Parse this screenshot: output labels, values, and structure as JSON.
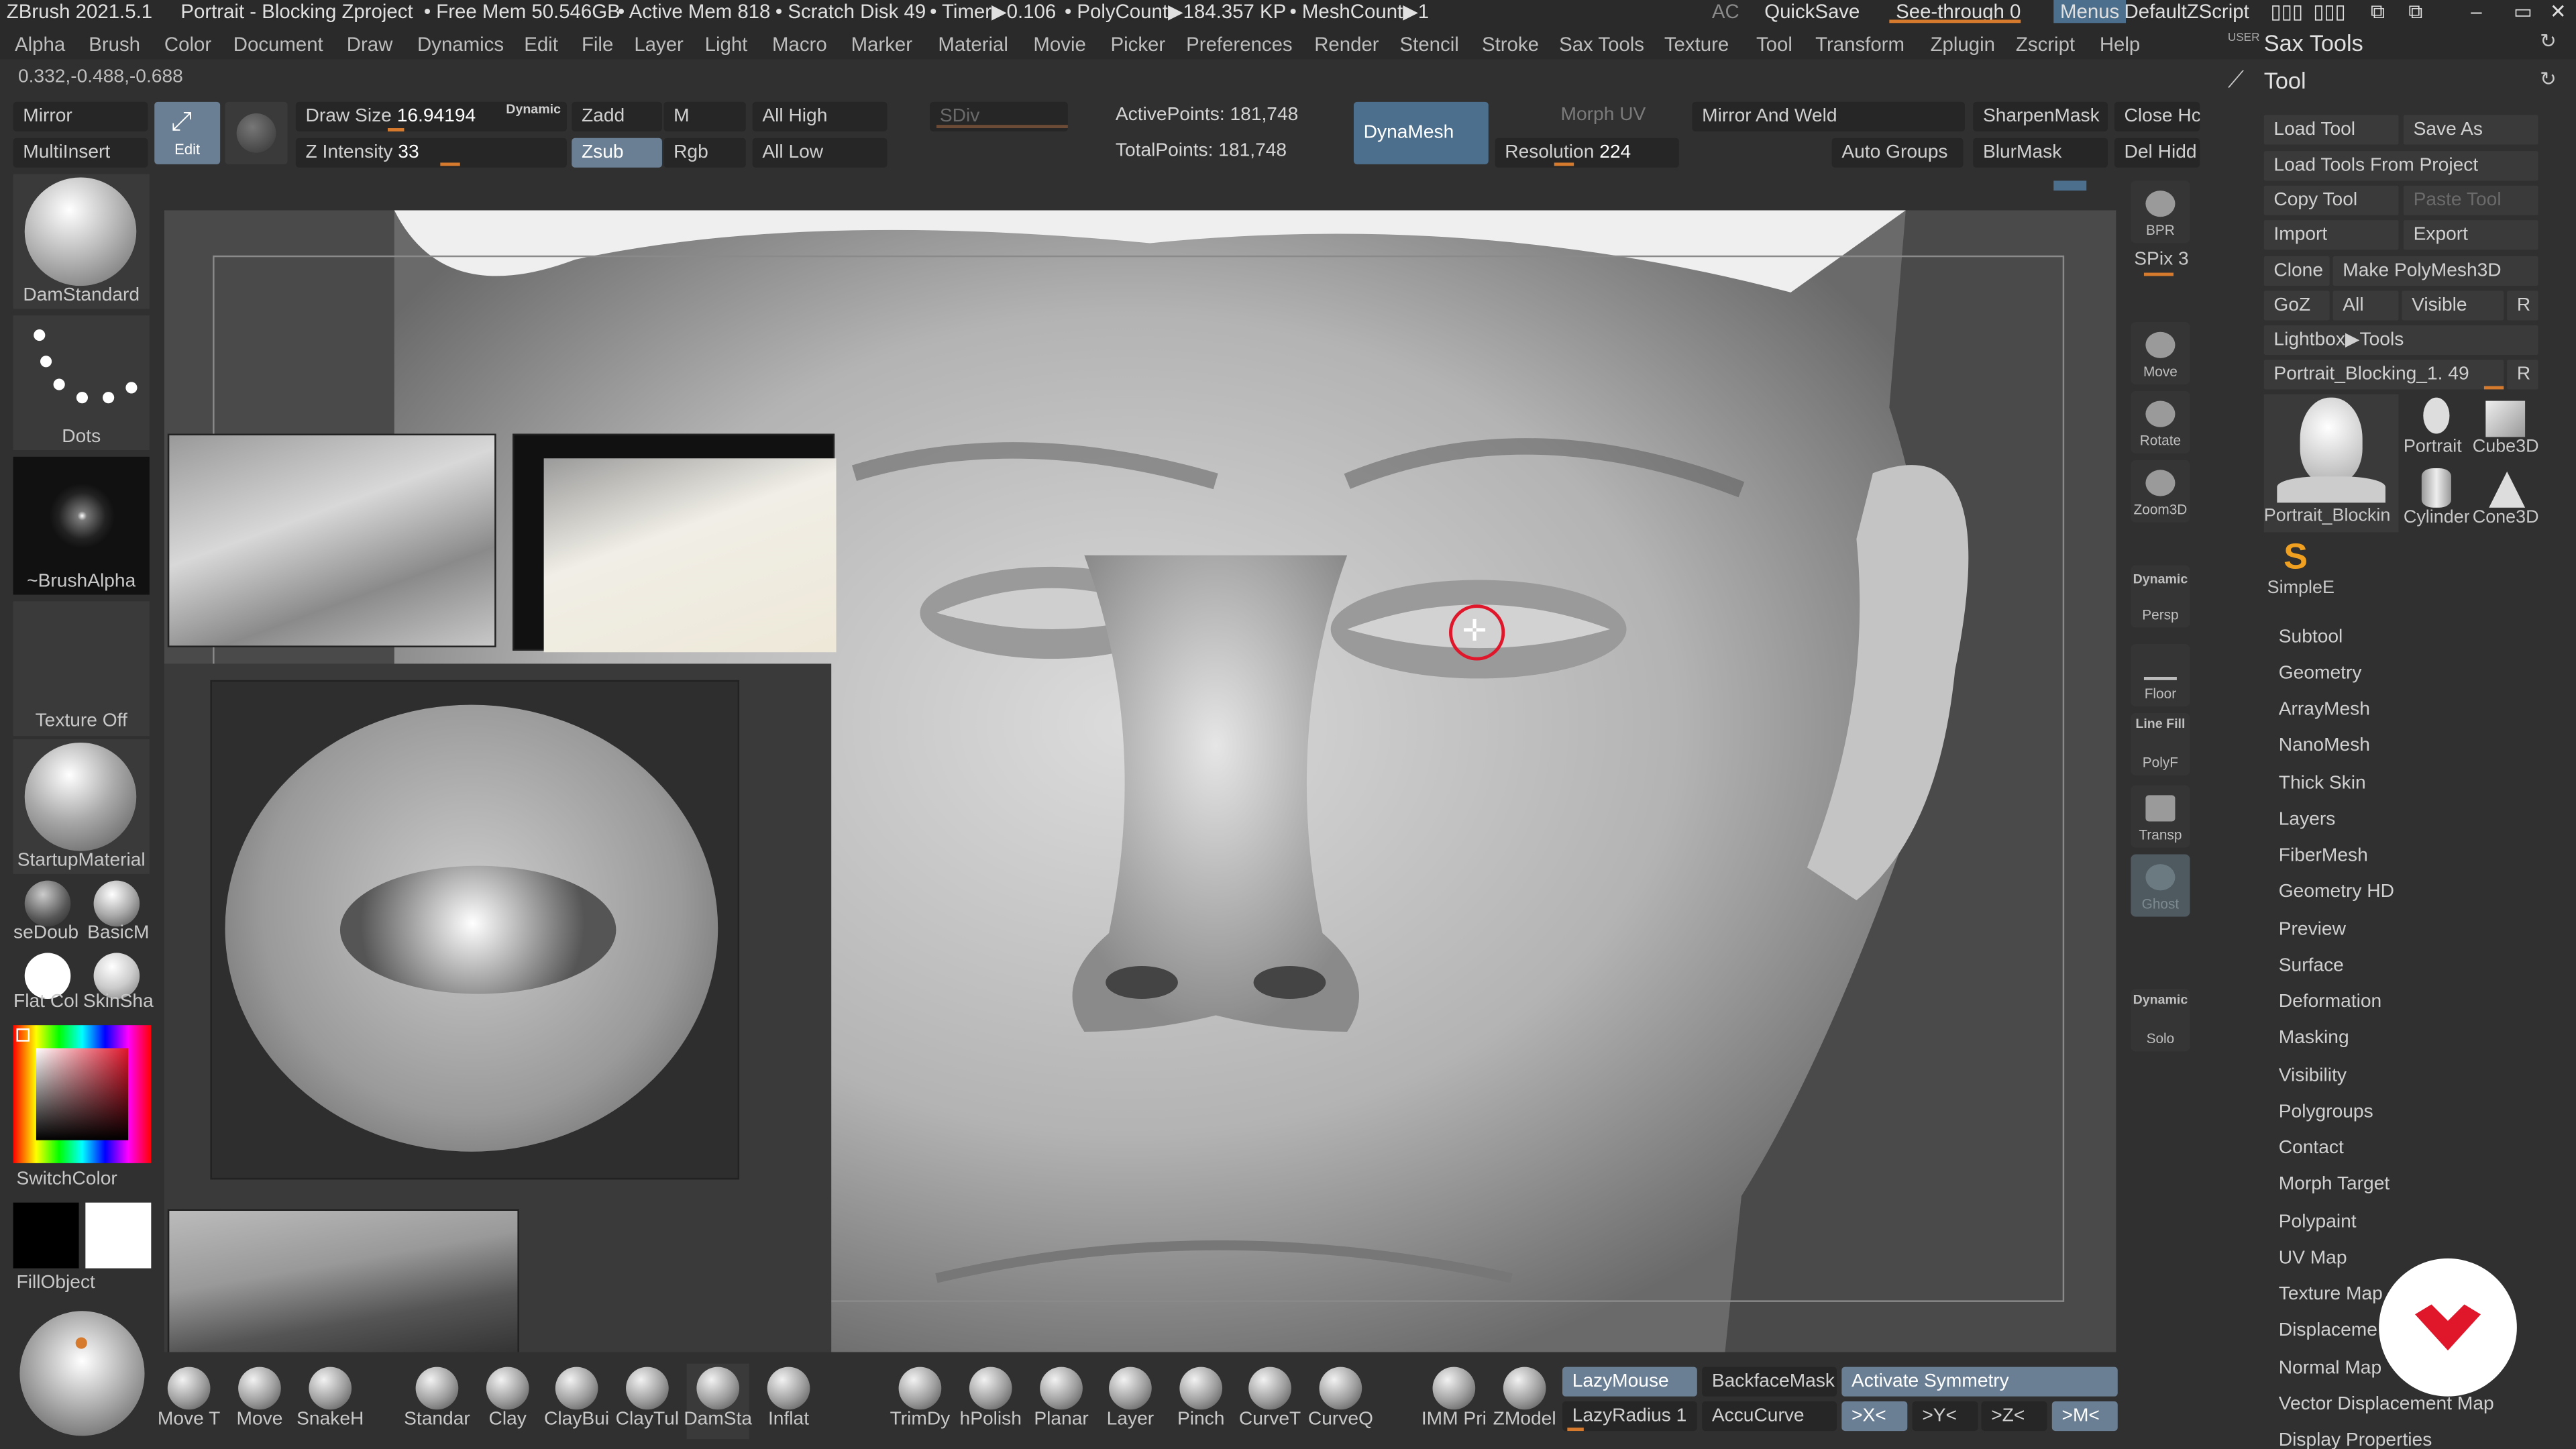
{
  "title": {
    "app": "ZBrush 2021.5.1",
    "doc": "Portrait - Blocking Zproject",
    "free_mem": "• Free Mem 50.546GB",
    "active_mem": "• Active Mem 818",
    "scratch": "• Scratch Disk 49",
    "timer": "• Timer▶0.106",
    "polycount": "• PolyCount▶184.357 KP",
    "meshcount": "• MeshCount▶1",
    "ac": "AC",
    "quicksave": "QuickSave",
    "see_through": "See-through  0",
    "menus": "Menus",
    "script": "DefaultZScript"
  },
  "menubar": [
    "Alpha",
    "Brush",
    "Color",
    "Document",
    "Draw",
    "Dynamics",
    "Edit",
    "File",
    "Layer",
    "Light",
    "Macro",
    "Marker",
    "Material",
    "Movie",
    "Picker",
    "Preferences",
    "Render",
    "Stencil",
    "Stroke",
    "Sax Tools",
    "Texture",
    "Tool",
    "Transform",
    "Zplugin",
    "Zscript",
    "Help"
  ],
  "coords": "0.332,-0.488,-0.688",
  "toolbar": {
    "mirror": "Mirror",
    "multiinsert": "MultiInsert",
    "edit": "Edit",
    "draw_size_label": "Draw Size",
    "draw_size_value": "16.94194",
    "dynamic": "Dynamic",
    "z_intensity_label": "Z Intensity",
    "z_intensity_value": "33",
    "zadd": "Zadd",
    "m": "M",
    "zsub": "Zsub",
    "rgb": "Rgb",
    "all_high": "All High",
    "all_low": "All Low",
    "sdiv": "SDiv",
    "active_points": "ActivePoints: 181,748",
    "total_points": "TotalPoints: 181,748",
    "dynamesh": "DynaMesh",
    "morph_uv": "Morph UV",
    "resolution_label": "Resolution",
    "resolution_value": "224",
    "mirror_weld": "Mirror And Weld",
    "auto_groups": "Auto Groups",
    "sharpen_mask": "SharpenMask",
    "blur_mask": "BlurMask",
    "close_holes": "Close Hc",
    "del_hidden": "Del Hidd"
  },
  "left": {
    "brush": "DamStandard",
    "stroke": "Dots",
    "alpha": "~BrushAlpha",
    "texture": "Texture Off",
    "material": "StartupMaterial",
    "mat1": "seDoub",
    "mat2": "BasicM",
    "mat3": "Flat Col",
    "mat4": "SkinSha",
    "switch_color": "SwitchColor",
    "fill_object": "FillObject"
  },
  "right_strip": {
    "bpr": "BPR",
    "spix": "SPix 3",
    "move": "Move",
    "rotate": "Rotate",
    "zoom": "Zoom3D",
    "persp_top": "Dynamic",
    "persp": "Persp",
    "floor": "Floor",
    "linefill": "Line Fill",
    "polyf": "PolyF",
    "transp": "Transp",
    "ghost": "Ghost",
    "solo_top": "Dynamic",
    "solo": "Solo"
  },
  "tool_panel": {
    "user": "USER",
    "sax_tools": "Sax Tools",
    "tool": "Tool",
    "load_tool": "Load Tool",
    "save_as": "Save As",
    "load_from_project": "Load Tools From Project",
    "copy_tool": "Copy Tool",
    "paste_tool": "Paste Tool",
    "import": "Import",
    "export": "Export",
    "clone": "Clone",
    "make_polymesh": "Make PolyMesh3D",
    "goz": "GoZ",
    "all": "All",
    "visible": "Visible",
    "r": "R",
    "lightbox": "Lightbox▶Tools",
    "current": "Portrait_Blocking_1. 49",
    "r2": "R",
    "thumbs": [
      "Portrait_Blockin",
      "Portrait",
      "Cube3D",
      "Cylinder",
      "Cone3D",
      "SimpleE"
    ],
    "menus": [
      "Subtool",
      "Geometry",
      "ArrayMesh",
      "NanoMesh",
      "Thick Skin",
      "Layers",
      "FiberMesh",
      "Geometry HD",
      "Preview",
      "Surface",
      "Deformation",
      "Masking",
      "Visibility",
      "Polygroups",
      "Contact",
      "Morph Target",
      "Polypaint",
      "UV Map",
      "Texture Map",
      "Displacement Map",
      "Normal Map",
      "Vector Displacement Map",
      "Display Properties"
    ]
  },
  "bottom": {
    "brushes": [
      "Move T",
      "Move",
      "SnakeH",
      "Standar",
      "Clay",
      "ClayBui",
      "ClayTul",
      "DamSta",
      "Inflat",
      "TrimDy",
      "hPolish",
      "Planar",
      "Layer",
      "Pinch",
      "CurveT",
      "CurveQ",
      "IMM Pri",
      "ZModel"
    ],
    "lazymouse": "LazyMouse",
    "lazyradius": "LazyRadius 1",
    "backface": "BackfaceMask",
    "accucurve": "AccuCurve",
    "symmetry": "Activate Symmetry",
    "x": ">X<",
    "y": ">Y<",
    "z": ">Z<",
    "m": ">M<"
  },
  "colors": {
    "accent_orange": "#d67a2e",
    "highlight_blue": "#6a7f94",
    "brand_red": "#e0162b"
  }
}
